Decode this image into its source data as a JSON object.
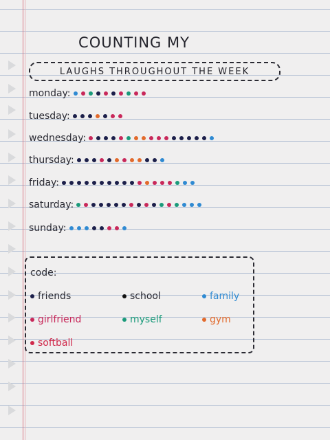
{
  "colors": {
    "friends": "#1c1f4a",
    "girlfriend": "#c8285a",
    "softball": "#d0284a",
    "school": "#111111",
    "myself": "#1a9a7a",
    "family": "#2f8ad2",
    "gym": "#e26a2c",
    "paper": "#f0efef",
    "rule": "#b6c2d4",
    "margin": "#d97a86"
  },
  "title": {
    "line1": "COUNTING MY",
    "line2": "LAUGHS THROUGHOUT THE WEEK"
  },
  "days": [
    {
      "label": "monday:",
      "dots": [
        "family",
        "girlfriend",
        "myself",
        "friends",
        "girlfriend",
        "friends",
        "girlfriend",
        "myself",
        "girlfriend",
        "girlfriend"
      ]
    },
    {
      "label": "tuesday:",
      "dots": [
        "friends",
        "friends",
        "friends",
        "gym",
        "friends",
        "girlfriend",
        "girlfriend"
      ]
    },
    {
      "label": "wednesday:",
      "dots": [
        "girlfriend",
        "friends",
        "friends",
        "friends",
        "girlfriend",
        "myself",
        "gym",
        "gym",
        "girlfriend",
        "girlfriend",
        "girlfriend",
        "friends",
        "friends",
        "friends",
        "friends",
        "friends",
        "family"
      ]
    },
    {
      "label": "thursday:",
      "dots": [
        "friends",
        "friends",
        "friends",
        "girlfriend",
        "friends",
        "gym",
        "girlfriend",
        "gym",
        "gym",
        "friends",
        "friends",
        "family"
      ]
    },
    {
      "label": "friday:",
      "dots": [
        "friends",
        "friends",
        "friends",
        "friends",
        "friends",
        "friends",
        "friends",
        "friends",
        "friends",
        "friends",
        "girlfriend",
        "gym",
        "girlfriend",
        "girlfriend",
        "girlfriend",
        "myself",
        "family",
        "family"
      ]
    },
    {
      "label": "saturday:",
      "dots": [
        "myself",
        "girlfriend",
        "friends",
        "friends",
        "friends",
        "friends",
        "friends",
        "girlfriend",
        "friends",
        "girlfriend",
        "friends",
        "myself",
        "girlfriend",
        "myself",
        "family",
        "family",
        "family"
      ]
    },
    {
      "label": "sunday:",
      "dots": [
        "family",
        "family",
        "family",
        "friends",
        "friends",
        "girlfriend",
        "girlfriend",
        "family"
      ]
    }
  ],
  "legend": {
    "label": "code:",
    "items": [
      {
        "key": "friends",
        "label": "friends"
      },
      {
        "key": "school",
        "label": "school"
      },
      {
        "key": "family",
        "label": "family"
      },
      {
        "key": "girlfriend",
        "label": "girlfriend"
      },
      {
        "key": "myself",
        "label": "myself"
      },
      {
        "key": "gym",
        "label": "gym"
      },
      {
        "key": "softball",
        "label": "softball"
      }
    ]
  }
}
